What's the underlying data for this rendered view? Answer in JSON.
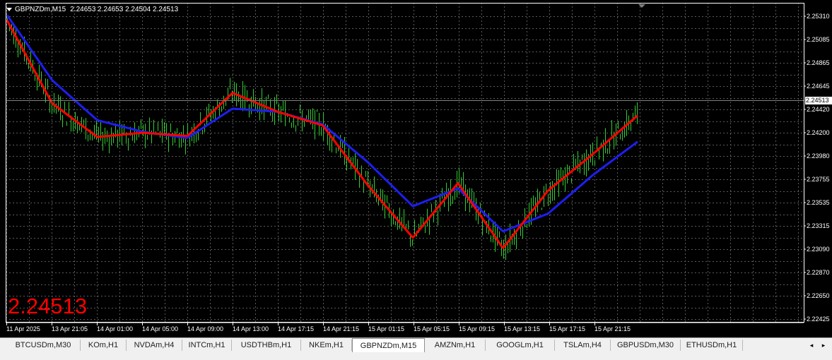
{
  "header": {
    "symbol": "GBPNZDm,M15",
    "quotes": "2.24653 2.24653 2.24504 2.24513",
    "menu_icon": "triangle-down-icon"
  },
  "big_price": "2.24513",
  "current_price_label": "2.24513",
  "colors": {
    "background": "#000000",
    "grid": "#5a5a5a",
    "candles": "#33cc33",
    "ma_fast": "#ff0000",
    "ma_slow": "#1e1ef0",
    "price_line": "#808080",
    "text": "#ffffff",
    "big_price": "#ff0000"
  },
  "y_axis_labels": [
    "2.25310",
    "2.25085",
    "2.24865",
    "2.24645",
    "2.24420",
    "2.24200",
    "2.23980",
    "2.23755",
    "2.23535",
    "2.23315",
    "2.23090",
    "2.22870",
    "2.22650",
    "2.22425"
  ],
  "x_axis_labels": [
    "11 Apr 2025",
    "13 Apr 21:05",
    "14 Apr 01:00",
    "14 Apr 05:00",
    "14 Apr 09:00",
    "14 Apr 13:00",
    "14 Apr 17:15",
    "14 Apr 21:15",
    "15 Apr 01:15",
    "15 Apr 05:15",
    "15 Apr 09:15",
    "15 Apr 13:15",
    "15 Apr 17:15",
    "15 Apr 21:15"
  ],
  "tabs": [
    {
      "label": "BTCUSDm,M30",
      "active": false
    },
    {
      "label": "KOm,H1",
      "active": false
    },
    {
      "label": "NVDAm,H4",
      "active": false
    },
    {
      "label": "INTCm,H1",
      "active": false
    },
    {
      "label": "USDTHBm,H1",
      "active": false
    },
    {
      "label": "NKEm,H1",
      "active": false
    },
    {
      "label": "GBPNZDm,M15",
      "active": true
    },
    {
      "label": "AMZNm,H1",
      "active": false
    },
    {
      "label": "GOOGLm,H1",
      "active": false
    },
    {
      "label": "TSLAm,H4",
      "active": false
    },
    {
      "label": "GBPUSDm,M30",
      "active": false
    },
    {
      "label": "ETHUSDm,H1",
      "active": false
    }
  ],
  "tab_scroll": {
    "left": "◂",
    "right": "▸"
  },
  "chart_data": {
    "type": "line",
    "x": [
      "11 Apr 2025",
      "13 Apr 21:05",
      "14 Apr 01:00",
      "14 Apr 05:00",
      "14 Apr 09:00",
      "14 Apr 13:00",
      "14 Apr 17:15",
      "14 Apr 21:15",
      "15 Apr 01:15",
      "15 Apr 05:15",
      "15 Apr 09:15",
      "15 Apr 13:15",
      "15 Apr 17:15",
      "15 Apr 21:15",
      "15 Apr 23:30"
    ],
    "series": [
      {
        "name": "",
        "color": "#ff0000",
        "values": [
          2.2527,
          2.2448,
          2.2416,
          2.242,
          2.2417,
          2.2458,
          2.244,
          2.2427,
          2.237,
          2.232,
          2.2372,
          2.231,
          2.2365,
          2.24,
          2.2437
        ]
      },
      {
        "name": "",
        "color": "#1e1ef0",
        "values": [
          2.2532,
          2.247,
          2.2432,
          2.2421,
          2.2415,
          2.2443,
          2.244,
          2.2428,
          2.2392,
          2.235,
          2.2367,
          2.2326,
          2.2343,
          2.238,
          2.2412
        ]
      }
    ],
    "ylim": [
      2.22425,
      2.2531
    ],
    "last_price": 2.24513,
    "grid": true
  }
}
